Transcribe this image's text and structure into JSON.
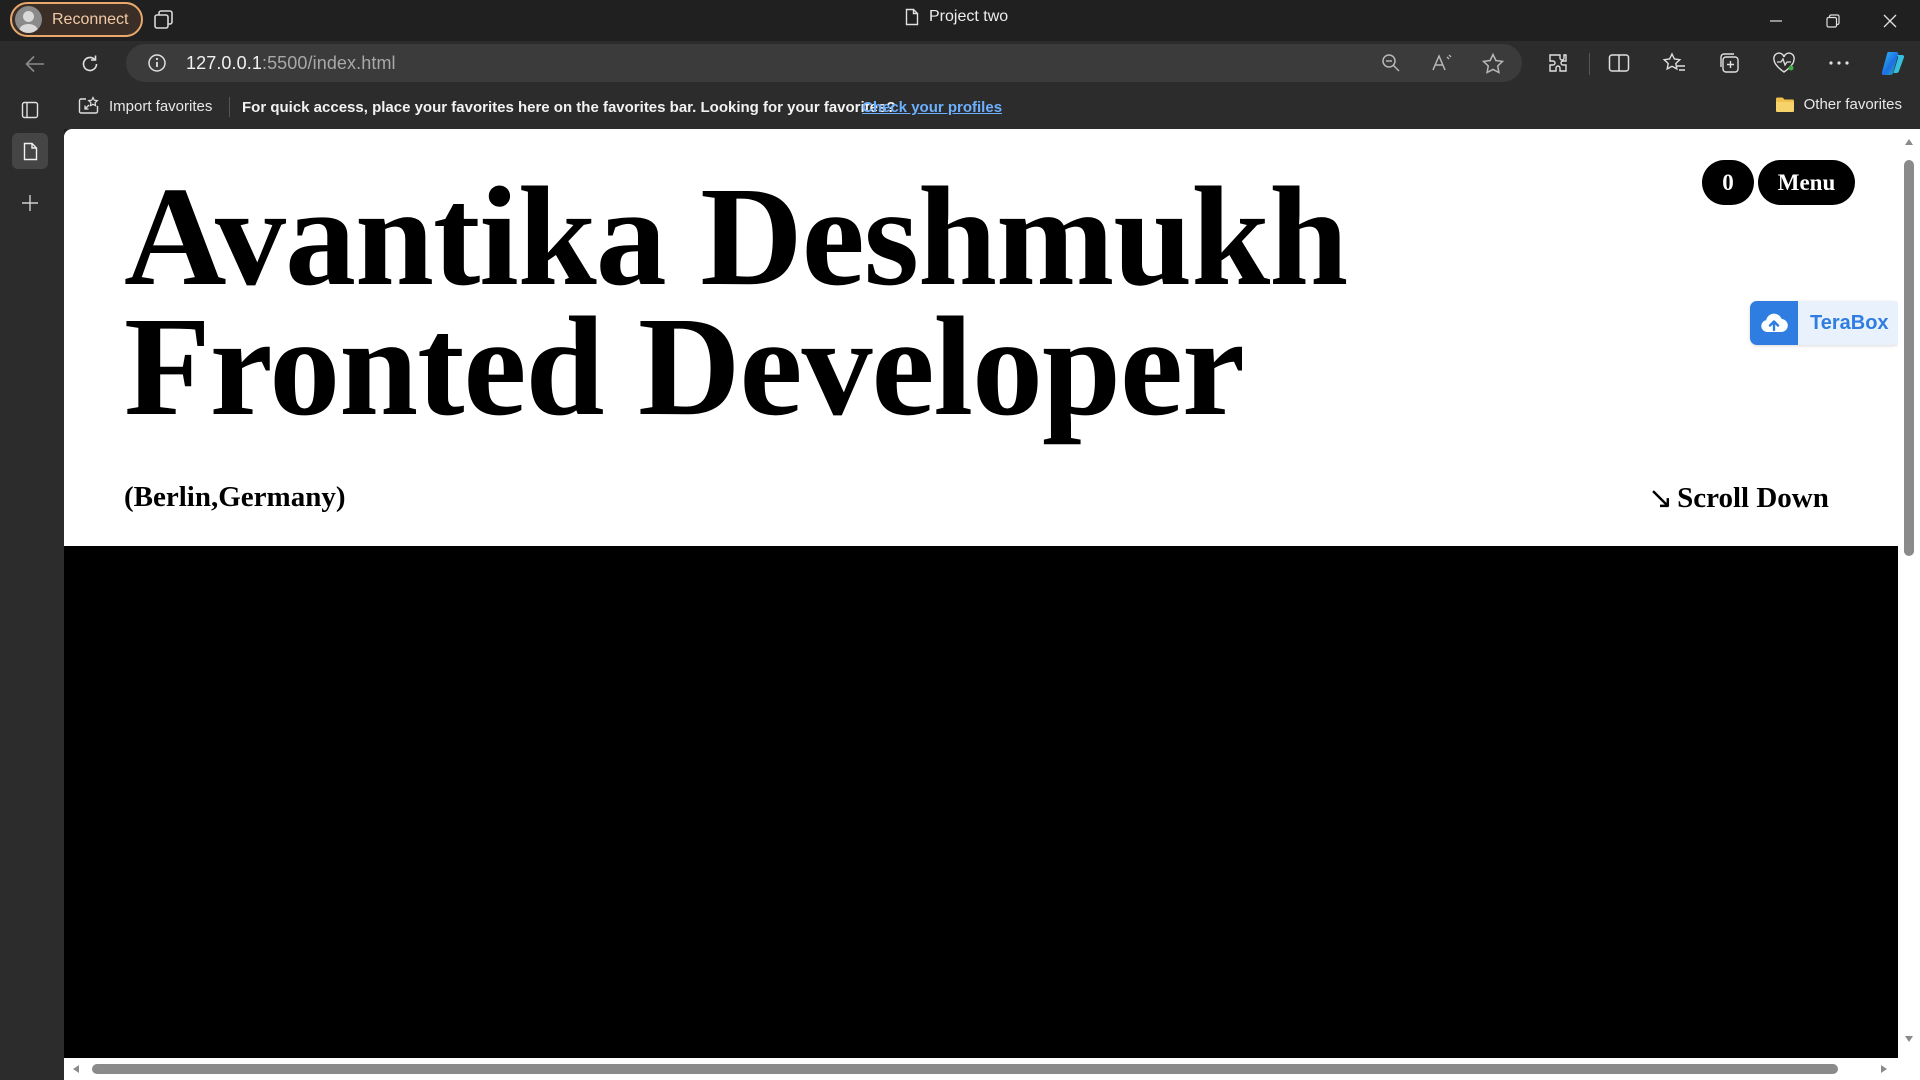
{
  "titlebar": {
    "reconnect_label": "Reconnect",
    "window_title": "Project two",
    "icons": [
      "profile-avatar-icon",
      "tab-actions-icon",
      "page-icon",
      "minimize-icon",
      "restore-icon",
      "close-icon"
    ]
  },
  "address_bar": {
    "url_host": "127.0.0.1",
    "url_rest": ":5500/index.html",
    "icons": [
      "back-arrow-icon",
      "refresh-icon",
      "site-info-icon",
      "zoom-out-icon",
      "read-aloud-icon",
      "favorite-star-icon",
      "extensions-icon",
      "split-screen-icon",
      "favorites-icon",
      "collections-icon",
      "browser-essentials-icon",
      "more-icon",
      "copilot-icon"
    ]
  },
  "favorites_bar": {
    "import_label": "Import favorites",
    "message": "For quick access, place your favorites here on the favorites bar. Looking for your favorites?",
    "link_label": "Check your profiles",
    "other_label": "Other favorites"
  },
  "sidebar": {
    "icons": [
      "tab-strip-icon",
      "page-tab-icon",
      "new-tab-plus-icon"
    ]
  },
  "page": {
    "title_line1": "Avantika Deshmukh",
    "title_line2": "Fronted Developer",
    "location": "(Berlin,Germany)",
    "scroll_arrow": "↘",
    "scroll_label": "Scroll Down",
    "counter_label": "0",
    "menu_label": "Menu",
    "terabox_label": "TeraBox"
  },
  "colors": {
    "chrome_bg": "#202020",
    "toolbar_bg": "#2c2c2c",
    "link": "#6cb0ff",
    "reconnect_border": "#e8a86c",
    "terabox_blue": "#2f7de1",
    "page_bg": "#ffffff",
    "section_bg": "#000000"
  }
}
